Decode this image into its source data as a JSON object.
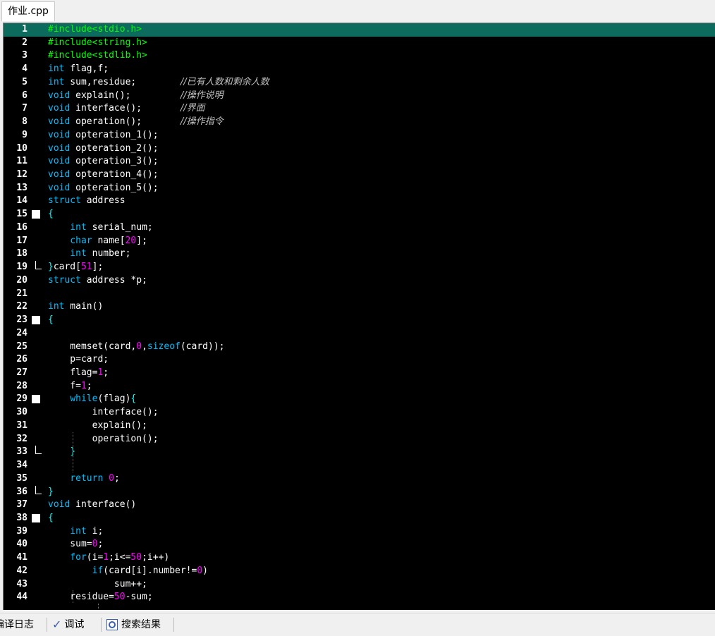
{
  "tab": {
    "label": "作业.cpp"
  },
  "editor": {
    "lines": [
      {
        "n": "1",
        "fold": "",
        "active": true,
        "segs": [
          {
            "t": "#include<stdio.h>",
            "c": "#00ff00"
          }
        ]
      },
      {
        "n": "2",
        "fold": "",
        "segs": [
          {
            "t": "#include<string.h>",
            "c": "#00ff00"
          }
        ]
      },
      {
        "n": "3",
        "fold": "",
        "segs": [
          {
            "t": "#include<stdlib.h>",
            "c": "#00ff00"
          }
        ]
      },
      {
        "n": "4",
        "fold": "",
        "segs": [
          {
            "t": "int",
            "c": "#00bfff"
          },
          {
            "t": " flag,f;",
            "c": "#ffffff"
          }
        ]
      },
      {
        "n": "5",
        "fold": "",
        "segs": [
          {
            "t": "int",
            "c": "#00bfff"
          },
          {
            "t": " sum,residue;        ",
            "c": "#ffffff"
          },
          {
            "t": "//已有人数和剩余人数",
            "c": "#c0c0c0",
            "i": true
          }
        ]
      },
      {
        "n": "6",
        "fold": "",
        "segs": [
          {
            "t": "void",
            "c": "#00bfff"
          },
          {
            "t": " explain();         ",
            "c": "#ffffff"
          },
          {
            "t": "//操作说明",
            "c": "#c0c0c0",
            "i": true
          }
        ]
      },
      {
        "n": "7",
        "fold": "",
        "segs": [
          {
            "t": "void",
            "c": "#00bfff"
          },
          {
            "t": " interface();       ",
            "c": "#ffffff"
          },
          {
            "t": "//界面",
            "c": "#c0c0c0",
            "i": true
          }
        ]
      },
      {
        "n": "8",
        "fold": "",
        "segs": [
          {
            "t": "void",
            "c": "#00bfff"
          },
          {
            "t": " operation();       ",
            "c": "#ffffff"
          },
          {
            "t": "//操作指令",
            "c": "#c0c0c0",
            "i": true
          }
        ]
      },
      {
        "n": "9",
        "fold": "",
        "segs": [
          {
            "t": "void",
            "c": "#00bfff"
          },
          {
            "t": " opteration_1();",
            "c": "#ffffff"
          }
        ]
      },
      {
        "n": "10",
        "fold": "",
        "segs": [
          {
            "t": "void",
            "c": "#00bfff"
          },
          {
            "t": " opteration_2();",
            "c": "#ffffff"
          }
        ]
      },
      {
        "n": "11",
        "fold": "",
        "segs": [
          {
            "t": "void",
            "c": "#00bfff"
          },
          {
            "t": " opteration_3();",
            "c": "#ffffff"
          }
        ]
      },
      {
        "n": "12",
        "fold": "",
        "segs": [
          {
            "t": "void",
            "c": "#00bfff"
          },
          {
            "t": " opteration_4();",
            "c": "#ffffff"
          }
        ]
      },
      {
        "n": "13",
        "fold": "",
        "segs": [
          {
            "t": "void",
            "c": "#00bfff"
          },
          {
            "t": " opteration_5();",
            "c": "#ffffff"
          }
        ]
      },
      {
        "n": "14",
        "fold": "",
        "segs": [
          {
            "t": "struct",
            "c": "#00bfff"
          },
          {
            "t": " address",
            "c": "#ffffff"
          }
        ]
      },
      {
        "n": "15",
        "fold": "open",
        "segs": [
          {
            "t": "{",
            "c": "#00ffff"
          }
        ]
      },
      {
        "n": "16",
        "fold": "",
        "segs": [
          {
            "t": "    ",
            "c": "#ffffff"
          },
          {
            "t": "int",
            "c": "#00bfff"
          },
          {
            "t": " serial_num;",
            "c": "#ffffff"
          }
        ]
      },
      {
        "n": "17",
        "fold": "",
        "segs": [
          {
            "t": "    ",
            "c": "#ffffff"
          },
          {
            "t": "char",
            "c": "#00bfff"
          },
          {
            "t": " name[",
            "c": "#ffffff"
          },
          {
            "t": "20",
            "c": "#ff00ff"
          },
          {
            "t": "];",
            "c": "#ffffff"
          }
        ]
      },
      {
        "n": "18",
        "fold": "",
        "segs": [
          {
            "t": "    ",
            "c": "#ffffff"
          },
          {
            "t": "int",
            "c": "#00bfff"
          },
          {
            "t": " number;",
            "c": "#ffffff"
          }
        ]
      },
      {
        "n": "19",
        "fold": "end",
        "segs": [
          {
            "t": "}",
            "c": "#00ffff"
          },
          {
            "t": "card[",
            "c": "#ffffff"
          },
          {
            "t": "51",
            "c": "#ff00ff"
          },
          {
            "t": "];",
            "c": "#ffffff"
          }
        ]
      },
      {
        "n": "20",
        "fold": "",
        "segs": [
          {
            "t": "struct",
            "c": "#00bfff"
          },
          {
            "t": " address *p;",
            "c": "#ffffff"
          }
        ]
      },
      {
        "n": "21",
        "fold": "",
        "segs": []
      },
      {
        "n": "22",
        "fold": "",
        "segs": [
          {
            "t": "int",
            "c": "#00bfff"
          },
          {
            "t": " main()",
            "c": "#ffffff"
          }
        ]
      },
      {
        "n": "23",
        "fold": "open",
        "segs": [
          {
            "t": "{",
            "c": "#00ffff"
          }
        ]
      },
      {
        "n": "24",
        "fold": "",
        "segs": []
      },
      {
        "n": "25",
        "fold": "",
        "segs": [
          {
            "t": "    memset(card,",
            "c": "#ffffff"
          },
          {
            "t": "0",
            "c": "#ff00ff"
          },
          {
            "t": ",",
            "c": "#ffffff"
          },
          {
            "t": "sizeof",
            "c": "#00bfff"
          },
          {
            "t": "(card));",
            "c": "#ffffff"
          }
        ]
      },
      {
        "n": "26",
        "fold": "",
        "segs": [
          {
            "t": "    p=card;",
            "c": "#ffffff"
          }
        ]
      },
      {
        "n": "27",
        "fold": "",
        "segs": [
          {
            "t": "    flag=",
            "c": "#ffffff"
          },
          {
            "t": "1",
            "c": "#ff00ff"
          },
          {
            "t": ";",
            "c": "#ffffff"
          }
        ]
      },
      {
        "n": "28",
        "fold": "",
        "segs": [
          {
            "t": "    f=",
            "c": "#ffffff"
          },
          {
            "t": "1",
            "c": "#ff00ff"
          },
          {
            "t": ";",
            "c": "#ffffff"
          }
        ]
      },
      {
        "n": "29",
        "fold": "open",
        "segs": [
          {
            "t": "    ",
            "c": "#ffffff"
          },
          {
            "t": "while",
            "c": "#00bfff"
          },
          {
            "t": "(flag)",
            "c": "#ffffff"
          },
          {
            "t": "{",
            "c": "#00ffff"
          }
        ]
      },
      {
        "n": "30",
        "fold": "",
        "segs": [
          {
            "t": "        interface();",
            "c": "#ffffff"
          }
        ]
      },
      {
        "n": "31",
        "fold": "",
        "segs": [
          {
            "t": "        explain();",
            "c": "#ffffff"
          }
        ]
      },
      {
        "n": "32",
        "fold": "",
        "segs": [
          {
            "t": "        operation();",
            "c": "#ffffff"
          }
        ]
      },
      {
        "n": "33",
        "fold": "end",
        "segs": [
          {
            "t": "    ",
            "c": "#ffffff"
          },
          {
            "t": "}",
            "c": "#00ffff"
          }
        ]
      },
      {
        "n": "34",
        "fold": "",
        "segs": []
      },
      {
        "n": "35",
        "fold": "",
        "segs": [
          {
            "t": "    ",
            "c": "#ffffff"
          },
          {
            "t": "return",
            "c": "#00bfff"
          },
          {
            "t": " ",
            "c": "#ffffff"
          },
          {
            "t": "0",
            "c": "#ff00ff"
          },
          {
            "t": ";",
            "c": "#ffffff"
          }
        ]
      },
      {
        "n": "36",
        "fold": "end",
        "segs": [
          {
            "t": "}",
            "c": "#00ffff"
          }
        ]
      },
      {
        "n": "37",
        "fold": "",
        "segs": [
          {
            "t": "void",
            "c": "#00bfff"
          },
          {
            "t": " interface()",
            "c": "#ffffff"
          }
        ]
      },
      {
        "n": "38",
        "fold": "open",
        "segs": [
          {
            "t": "{",
            "c": "#00ffff"
          }
        ]
      },
      {
        "n": "39",
        "fold": "",
        "segs": [
          {
            "t": "    ",
            "c": "#ffffff"
          },
          {
            "t": "int",
            "c": "#00bfff"
          },
          {
            "t": " i;",
            "c": "#ffffff"
          }
        ]
      },
      {
        "n": "40",
        "fold": "",
        "segs": [
          {
            "t": "    sum=",
            "c": "#ffffff"
          },
          {
            "t": "0",
            "c": "#ff00ff"
          },
          {
            "t": ";",
            "c": "#ffffff"
          }
        ]
      },
      {
        "n": "41",
        "fold": "",
        "segs": [
          {
            "t": "    ",
            "c": "#ffffff"
          },
          {
            "t": "for",
            "c": "#00bfff"
          },
          {
            "t": "(i=",
            "c": "#ffffff"
          },
          {
            "t": "1",
            "c": "#ff00ff"
          },
          {
            "t": ";i<=",
            "c": "#ffffff"
          },
          {
            "t": "50",
            "c": "#ff00ff"
          },
          {
            "t": ";i++)",
            "c": "#ffffff"
          }
        ]
      },
      {
        "n": "42",
        "fold": "",
        "segs": [
          {
            "t": "        ",
            "c": "#ffffff"
          },
          {
            "t": "if",
            "c": "#00bfff"
          },
          {
            "t": "(card[i].number!=",
            "c": "#ffffff"
          },
          {
            "t": "0",
            "c": "#ff00ff"
          },
          {
            "t": ")",
            "c": "#ffffff"
          }
        ]
      },
      {
        "n": "43",
        "fold": "",
        "segs": [
          {
            "t": "            sum++;",
            "c": "#ffffff"
          }
        ]
      },
      {
        "n": "44",
        "fold": "",
        "segs": [
          {
            "t": "    residue=",
            "c": "#ffffff"
          },
          {
            "t": "50",
            "c": "#ff00ff"
          },
          {
            "t": "-sum;",
            "c": "#ffffff"
          }
        ]
      }
    ]
  },
  "statusbar": {
    "items": [
      {
        "label": "编译日志",
        "icon": "compile-log-icon"
      },
      {
        "label": "调试",
        "icon": "check-icon"
      },
      {
        "label": "搜索结果",
        "icon": "search-results-icon"
      }
    ]
  }
}
